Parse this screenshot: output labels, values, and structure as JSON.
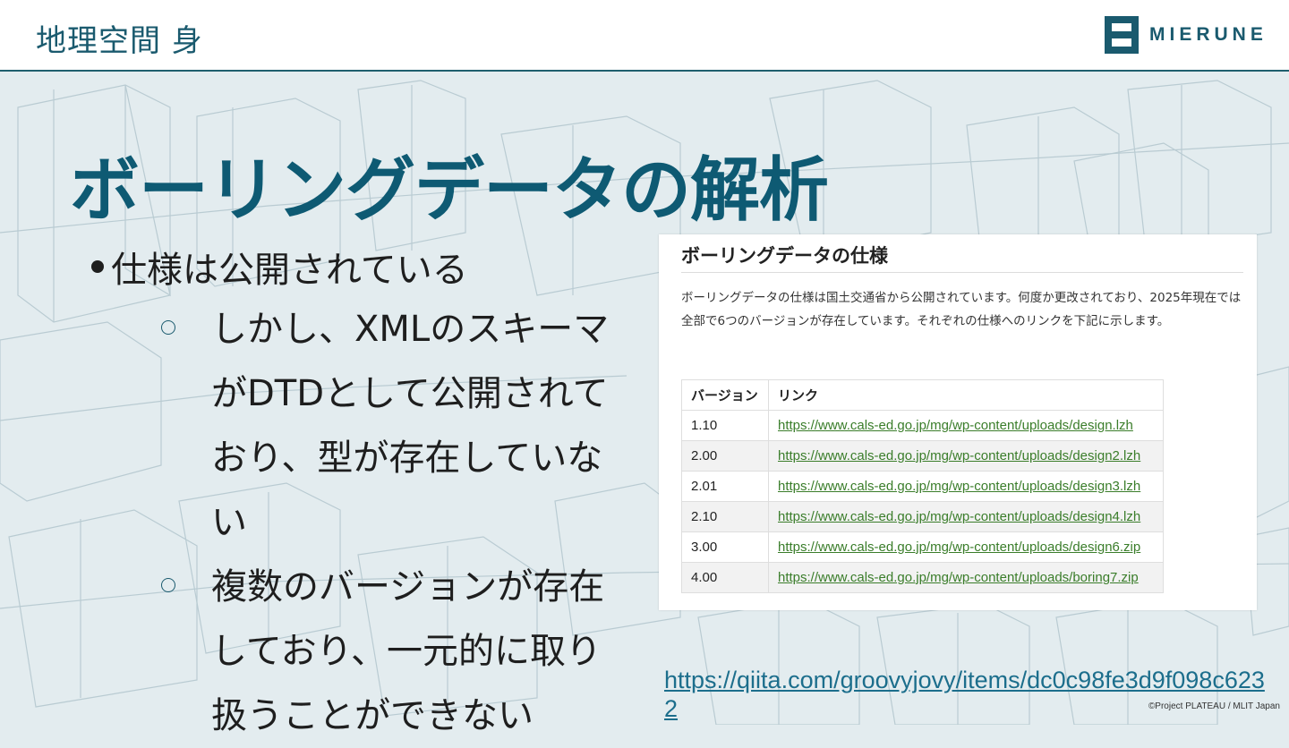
{
  "header": {
    "title": "地理空間 身",
    "logo_text": "MIERUNE"
  },
  "slide": {
    "title": "ボーリングデータの解析",
    "bullets": [
      {
        "text": "仕様は公開されている",
        "children": [
          "しかし、XMLのスキーマがDTDとして公開されており、型が存在していない",
          "複数のバージョンが存在しており、一元的に取り扱うことができない"
        ]
      }
    ]
  },
  "screenshot": {
    "heading": "ボーリングデータの仕様",
    "description": "ボーリングデータの仕様は国土交通省から公開されています。何度か更改されており、2025年現在では全部で6つのバージョンが存在しています。それぞれの仕様へのリンクを下記に示します。",
    "table": {
      "headers": [
        "バージョン",
        "リンク"
      ],
      "rows": [
        {
          "version": "1.10",
          "link": "https://www.cals-ed.go.jp/mg/wp-content/uploads/design.lzh"
        },
        {
          "version": "2.00",
          "link": "https://www.cals-ed.go.jp/mg/wp-content/uploads/design2.lzh"
        },
        {
          "version": "2.01",
          "link": "https://www.cals-ed.go.jp/mg/wp-content/uploads/design3.lzh"
        },
        {
          "version": "2.10",
          "link": "https://www.cals-ed.go.jp/mg/wp-content/uploads/design4.lzh"
        },
        {
          "version": "3.00",
          "link": "https://www.cals-ed.go.jp/mg/wp-content/uploads/design6.zip"
        },
        {
          "version": "4.00",
          "link": "https://www.cals-ed.go.jp/mg/wp-content/uploads/boring7.zip"
        }
      ]
    }
  },
  "source_link": "https://qiita.com/groovyjovy/items/dc0c98fe3d9f098c6232",
  "credit": "©Project PLATEAU / MLIT Japan",
  "colors": {
    "brand": "#1a5a6e",
    "title": "#0e5a73",
    "link_green": "#3a7d2a",
    "link_blue": "#1c6e8c"
  }
}
